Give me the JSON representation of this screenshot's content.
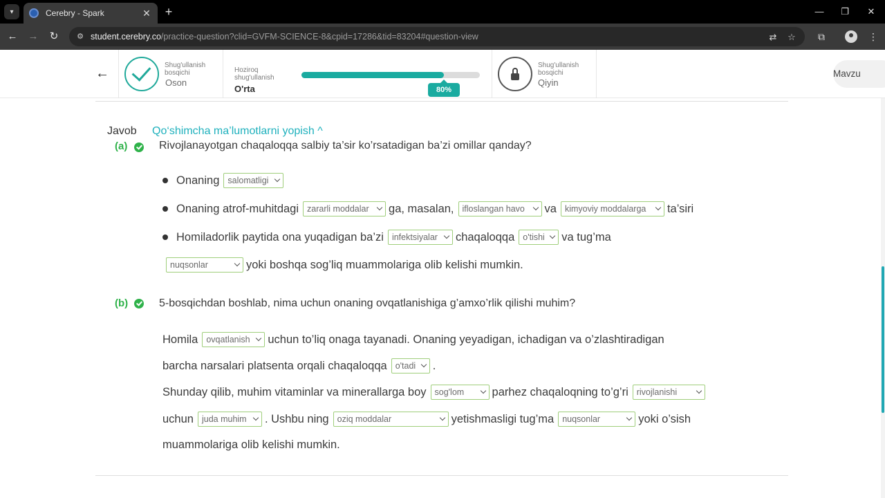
{
  "browser": {
    "tab_title": "Cerebry - Spark",
    "url_host": "student.cerebry.co",
    "url_path": "/practice-question?clid=GVFM-SCIENCE-8&cpid=17286&tid=83204#question-view"
  },
  "header": {
    "prev_stage": {
      "small": "Shug'ullanish bosqichi",
      "level": "Oson"
    },
    "current_stage": {
      "small": "Hoziroq shug'ullanish",
      "level": "O'rta"
    },
    "progress": {
      "value": 80,
      "label": "80%"
    },
    "next_stage": {
      "small": "Shug'ullanish bosqichi",
      "level": "Qiyin"
    },
    "topic_button": "Mavzu"
  },
  "answer": {
    "label": "Javob",
    "toggle": "Qo‘shimcha ma’lumotlarni yopish ^"
  },
  "part_a": {
    "label": "(a)",
    "question": "Rivojlanayotgan chaqaloqqa salbiy ta’sir ko’rsatadigan ba’zi omillar qanday?",
    "bullet1": {
      "pre": "Onaning",
      "dd1": "salomatligi"
    },
    "bullet2": {
      "pre": "Onaning atrof-muhitdagi",
      "dd1": "zararli moddalar",
      "mid1": "ga, masalan,",
      "dd2": "ifloslangan havo",
      "mid2": "va",
      "dd3": "kimyoviy moddalarga",
      "post": "ta’siri"
    },
    "bullet3": {
      "pre": "Homiladorlik paytida ona yuqadigan ba’zi",
      "dd1": "infektsiyalar",
      "mid1": "chaqaloqqa",
      "dd2": "o'tishi",
      "post": "va tug’ma"
    },
    "line4": {
      "dd1": "nuqsonlar",
      "post": "yoki boshqa sog’liq muammolariga olib kelishi mumkin."
    }
  },
  "part_b": {
    "label": "(b)",
    "question": "5-bosqichdan boshlab, nima uchun onaning ovqatlanishiga g’amxo’rlik qilishi muhim?",
    "line1": {
      "pre": "Homila",
      "dd1": "ovqatlanish",
      "post": "uchun to’liq onaga tayanadi. Onaning yeyadigan, ichadigan va o’zlashtiradigan"
    },
    "line2": {
      "pre": "barcha narsalari platsenta orqali chaqaloqqa",
      "dd1": "o'tadi",
      "post": "."
    },
    "line3": {
      "pre": "Shunday qilib, muhim vitaminlar va minerallarga boy",
      "dd1": "sog'lom",
      "mid1": "parhez chaqaloqning to’g’ri",
      "dd2": "rivojlanishi"
    },
    "line4": {
      "pre": "uchun",
      "dd1": "juda muhim",
      "mid1": ". Ushbu ning",
      "dd2": "oziq moddalar",
      "mid2": "yetishmasligi tug’ma",
      "dd3": "nuqsonlar",
      "post": "yoki o’sish"
    },
    "line5": {
      "pre": "muammolariga olib kelishi mumkin."
    }
  }
}
